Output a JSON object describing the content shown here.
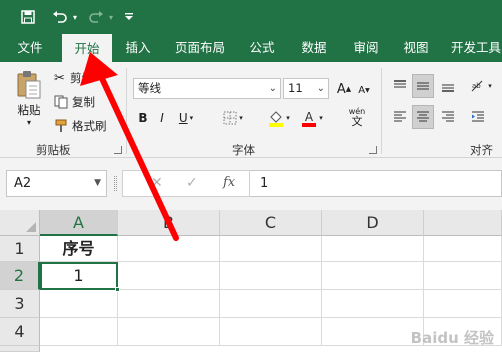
{
  "qat": {
    "save_icon": "save-icon",
    "undo_icon": "undo-icon",
    "redo_icon": "redo-icon",
    "customize_icon": "customize-qat-icon"
  },
  "tabs": [
    {
      "label": "文件",
      "active": false
    },
    {
      "label": "开始",
      "active": true
    },
    {
      "label": "插入",
      "active": false
    },
    {
      "label": "页面布局",
      "active": false
    },
    {
      "label": "公式",
      "active": false
    },
    {
      "label": "数据",
      "active": false
    },
    {
      "label": "审阅",
      "active": false
    },
    {
      "label": "视图",
      "active": false
    },
    {
      "label": "开发工具",
      "active": false
    }
  ],
  "clipboard": {
    "paste": "粘贴",
    "cut": "剪切",
    "copy": "复制",
    "format_painter": "格式刷",
    "group_label": "剪贴板"
  },
  "font": {
    "name": "等线",
    "size": "11",
    "bold": "B",
    "italic": "I",
    "underline": "U",
    "grow": "A",
    "shrink": "A",
    "wen": "wén",
    "wen_char": "文",
    "group_label": "字体",
    "fill_color": "#ffff00",
    "font_color": "#ff0000"
  },
  "alignment": {
    "group_label": "对齐方"
  },
  "formula_bar": {
    "name_box": "A2",
    "cancel": "✕",
    "enter": "✓",
    "fx": "fx",
    "value": "1"
  },
  "grid": {
    "columns": [
      "A",
      "B",
      "C",
      "D"
    ],
    "rows": [
      "1",
      "2",
      "3",
      "4"
    ],
    "cells": {
      "A1": "序号",
      "A2": "1"
    },
    "selected_cell": "A2"
  },
  "accent_color": "#217346",
  "annotation_color": "#ff0000",
  "watermark": "Baidu 经验"
}
